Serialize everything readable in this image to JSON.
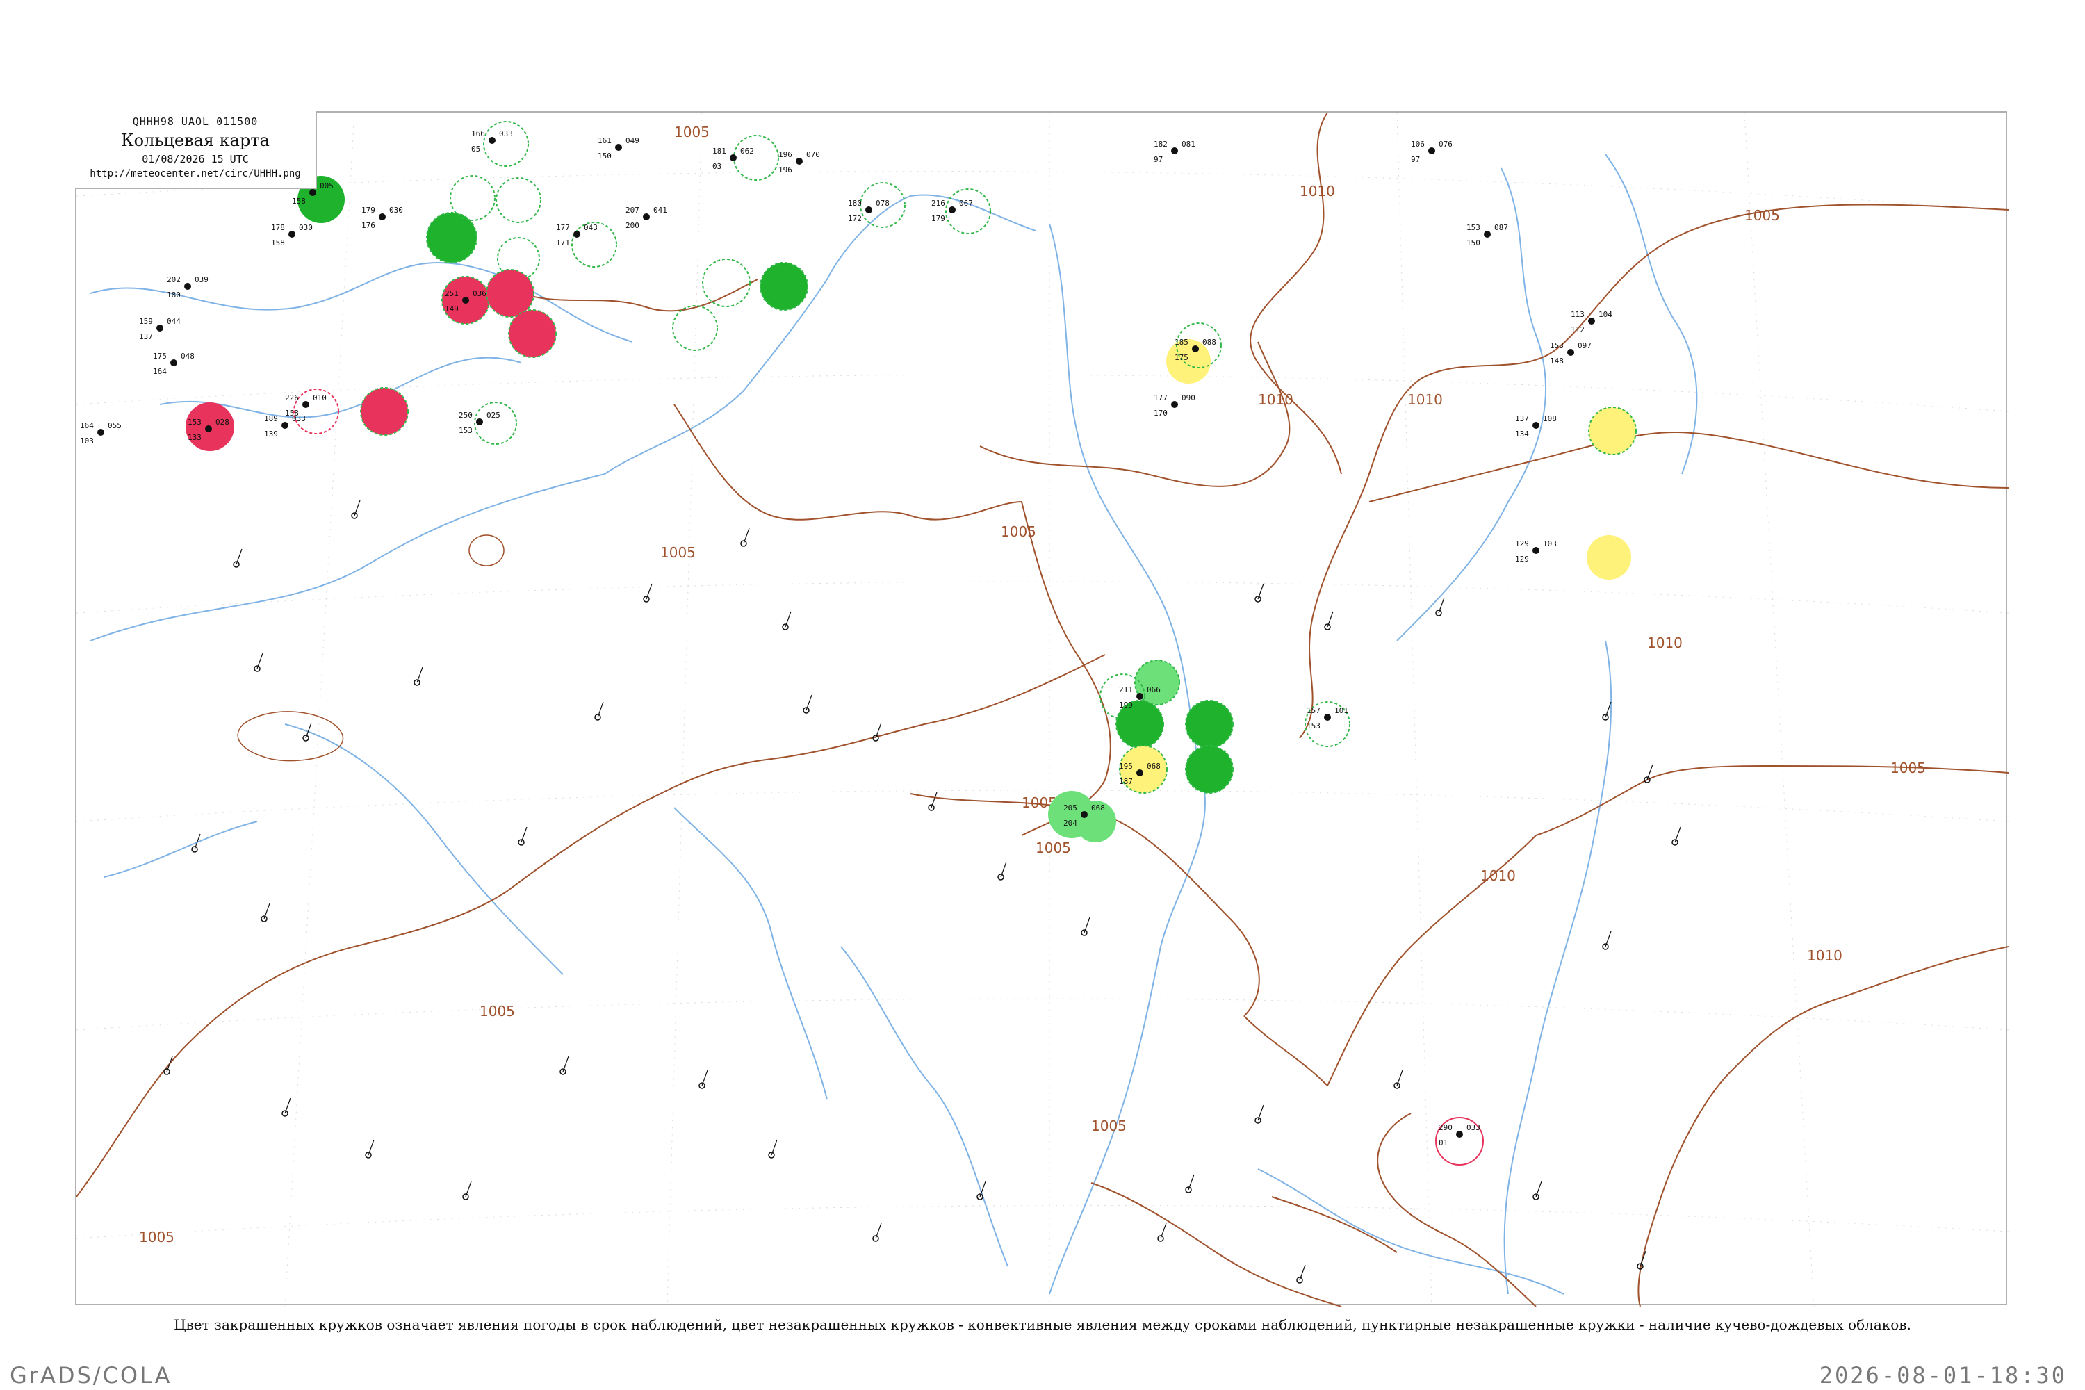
{
  "header": {
    "code": "QHHH98  UAOL  011500",
    "title": "Кольцевая карта",
    "datetime": "01/08/2026 15 UTC",
    "url": "http://meteocenter.net/circ/UHHH.png"
  },
  "caption": "Цвет закрашенных кружков означает явления погоды в срок наблюдений, цвет незакрашенных кружков - конвективные явления между сроками наблюдений, пунктирные незакрашенные кружки - наличие кучево-дождевых облаков.",
  "footer": {
    "software": "GrADS/COLA",
    "rendered_at": "2026-08-01-18:30"
  },
  "colors": {
    "isobar": "#a0522d",
    "river": "#7fb3e6",
    "border": "#b0b0b0",
    "thunder_green": "#1fb32d",
    "shower_light_green": "#6ee07a",
    "rain_red": "#e8335c",
    "fog_yellow": "#fff27a",
    "cb_dashed": "#33b84a"
  },
  "isobar_labels": [
    "1005",
    "1010",
    "1005",
    "1010",
    "1010",
    "1010",
    "1005",
    "1005",
    "1005",
    "1005",
    "1005",
    "1010",
    "1005",
    "1005",
    "1005",
    "1010"
  ],
  "stations": [
    {
      "t": "163",
      "p": "005",
      "dp": "158",
      "id": "",
      "fill": "#1fb32d",
      "ring": false
    },
    {
      "t": "166",
      "p": "033",
      "dp": "05",
      "id": "",
      "fill": "",
      "ring": true
    },
    {
      "t": "179",
      "p": "030",
      "dp": "176",
      "id": "",
      "fill": "",
      "ring": false
    },
    {
      "t": "178",
      "p": "030",
      "dp": "158",
      "id": "",
      "fill": "",
      "ring": true
    },
    {
      "t": "202",
      "p": "039",
      "dp": "180",
      "id": "",
      "fill": "",
      "ring": false
    },
    {
      "t": "159",
      "p": "044",
      "dp": "137",
      "id": "",
      "fill": "",
      "ring": false
    },
    {
      "t": "175",
      "p": "048",
      "dp": "164",
      "id": "",
      "fill": "",
      "ring": false
    },
    {
      "t": "164",
      "p": "055",
      "dp": "103",
      "id": "",
      "fill": "",
      "ring": false
    },
    {
      "t": "161",
      "p": "049",
      "dp": "150",
      "id": "",
      "fill": "",
      "ring": false
    },
    {
      "t": "177",
      "p": "043",
      "dp": "171",
      "id": "",
      "fill": "",
      "ring": true
    },
    {
      "t": "207",
      "p": "041",
      "dp": "200",
      "id": "",
      "fill": "",
      "ring": false
    },
    {
      "t": "181",
      "p": "062",
      "dp": "03",
      "id": "",
      "fill": "",
      "ring": true
    },
    {
      "t": "196",
      "p": "070",
      "dp": "196",
      "id": "",
      "fill": "",
      "ring": false
    },
    {
      "t": "180",
      "p": "078",
      "dp": "172",
      "id": "",
      "fill": "",
      "ring": true
    },
    {
      "t": "216",
      "p": "067",
      "dp": "179",
      "id": "",
      "fill": "",
      "ring": true
    },
    {
      "t": "182",
      "p": "081",
      "dp": "97",
      "id": "",
      "fill": "",
      "ring": false
    },
    {
      "t": "106",
      "p": "076",
      "dp": "97",
      "id": "",
      "fill": "",
      "ring": false
    },
    {
      "t": "153",
      "p": "087",
      "dp": "150",
      "id": "",
      "fill": "",
      "ring": false
    },
    {
      "t": "153",
      "p": "097",
      "dp": "148",
      "id": "",
      "fill": "",
      "ring": false
    },
    {
      "t": "113",
      "p": "104",
      "dp": "112",
      "id": "",
      "fill": "",
      "ring": false
    },
    {
      "t": "137",
      "p": "108",
      "dp": "134",
      "id": "",
      "fill": "#fff27a",
      "ring": true
    },
    {
      "t": "129",
      "p": "103",
      "dp": "129",
      "id": "",
      "fill": "#fff27a",
      "ring": false
    },
    {
      "t": "177",
      "p": "090",
      "dp": "170",
      "id": "",
      "fill": "#fff27a",
      "ring": false
    },
    {
      "t": "185",
      "p": "088",
      "dp": "175",
      "id": "",
      "fill": "",
      "ring": true
    },
    {
      "t": "251",
      "p": "036",
      "dp": "149",
      "id": "",
      "fill": "#e8335c",
      "ring": true
    },
    {
      "t": "226",
      "p": "010",
      "dp": "158",
      "id": "",
      "fill": "#e8335c",
      "ring": true
    },
    {
      "t": "189",
      "p": "033",
      "dp": "139",
      "id": "",
      "fill": "",
      "ring": true
    },
    {
      "t": "153",
      "p": "028",
      "dp": "133",
      "id": "",
      "fill": "#e8335c",
      "ring": true
    },
    {
      "t": "250",
      "p": "025",
      "dp": "153",
      "id": "",
      "fill": "",
      "ring": true
    },
    {
      "t": "211",
      "p": "066",
      "dp": "199",
      "id": "",
      "fill": "#6ee07a",
      "ring": true
    },
    {
      "t": "195",
      "p": "068",
      "dp": "187",
      "id": "",
      "fill": "#fff27a",
      "ring": false
    },
    {
      "t": "205",
      "p": "068",
      "dp": "204",
      "id": "",
      "fill": "#6ee07a",
      "ring": false
    },
    {
      "t": "290",
      "p": "033",
      "dp": "01",
      "id": "",
      "fill": "",
      "ring": true
    },
    {
      "t": "157",
      "p": "101",
      "dp": "153",
      "id": "",
      "fill": "",
      "ring": true
    }
  ]
}
